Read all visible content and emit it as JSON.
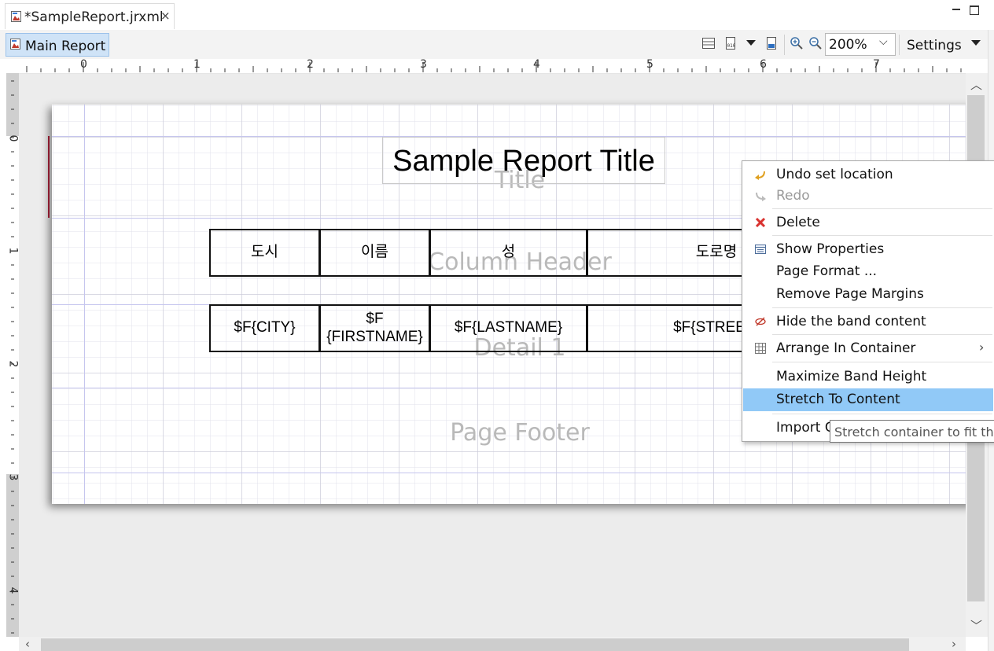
{
  "editor_tab": {
    "title": "*SampleReport.jrxml",
    "close_glyph": "×",
    "icon": "report-file-icon"
  },
  "toolbar": {
    "main_report_label": "Main Report",
    "zoom_value": "200%",
    "zoom_dropdown_glyph": "⌵",
    "settings_label": "Settings",
    "zoom_in_glyph": "⊕",
    "zoom_out_glyph": "⊖"
  },
  "ruler": {
    "top_numbers": [
      "0",
      "1",
      "2",
      "3",
      "4",
      "5",
      "6",
      "7"
    ],
    "left_numbers": [
      "0",
      "1",
      "2",
      "3",
      "4"
    ]
  },
  "report": {
    "title_text": "Sample Report Title",
    "bands": {
      "title": "Title",
      "column_header": "Column Header",
      "detail": "Detail 1",
      "page_footer": "Page Footer"
    },
    "column_headers": [
      "도시",
      "이름",
      "성",
      "도로명"
    ],
    "detail_fields": [
      "$F{CITY}",
      "$F\n{FIRSTNAME}",
      "$F{LASTNAME}",
      "$F{STREET}"
    ]
  },
  "context_menu": {
    "items": [
      {
        "label": "Undo set location",
        "icon": "undo-icon",
        "enabled": true
      },
      {
        "label": "Redo",
        "icon": "redo-icon",
        "enabled": false
      },
      {
        "label": "Delete",
        "icon": "delete-icon",
        "enabled": true
      },
      {
        "label": "Show Properties",
        "icon": "properties-icon",
        "enabled": true
      },
      {
        "label": "Page Format ...",
        "enabled": true
      },
      {
        "label": "Remove Page Margins",
        "enabled": true
      },
      {
        "label": "Hide the band content",
        "icon": "hide-icon",
        "enabled": true
      },
      {
        "label": "Arrange In Container",
        "icon": "grid-icon",
        "enabled": true,
        "submenu": "›"
      },
      {
        "label": "Maximize Band Height",
        "enabled": true
      },
      {
        "label": "Stretch To Content",
        "enabled": true,
        "highlighted": true
      },
      {
        "label": "Import C",
        "enabled": true
      }
    ]
  },
  "tooltip": {
    "text": "Stretch container to fit th"
  },
  "colors": {
    "menu_highlight": "#91c9f7",
    "selected_tool": "#cfe3f7",
    "band_line": "#c6c6ee",
    "band_label": "#b9b9b9",
    "delete_icon": "#d9322f",
    "undo_icon": "#e0a020"
  }
}
